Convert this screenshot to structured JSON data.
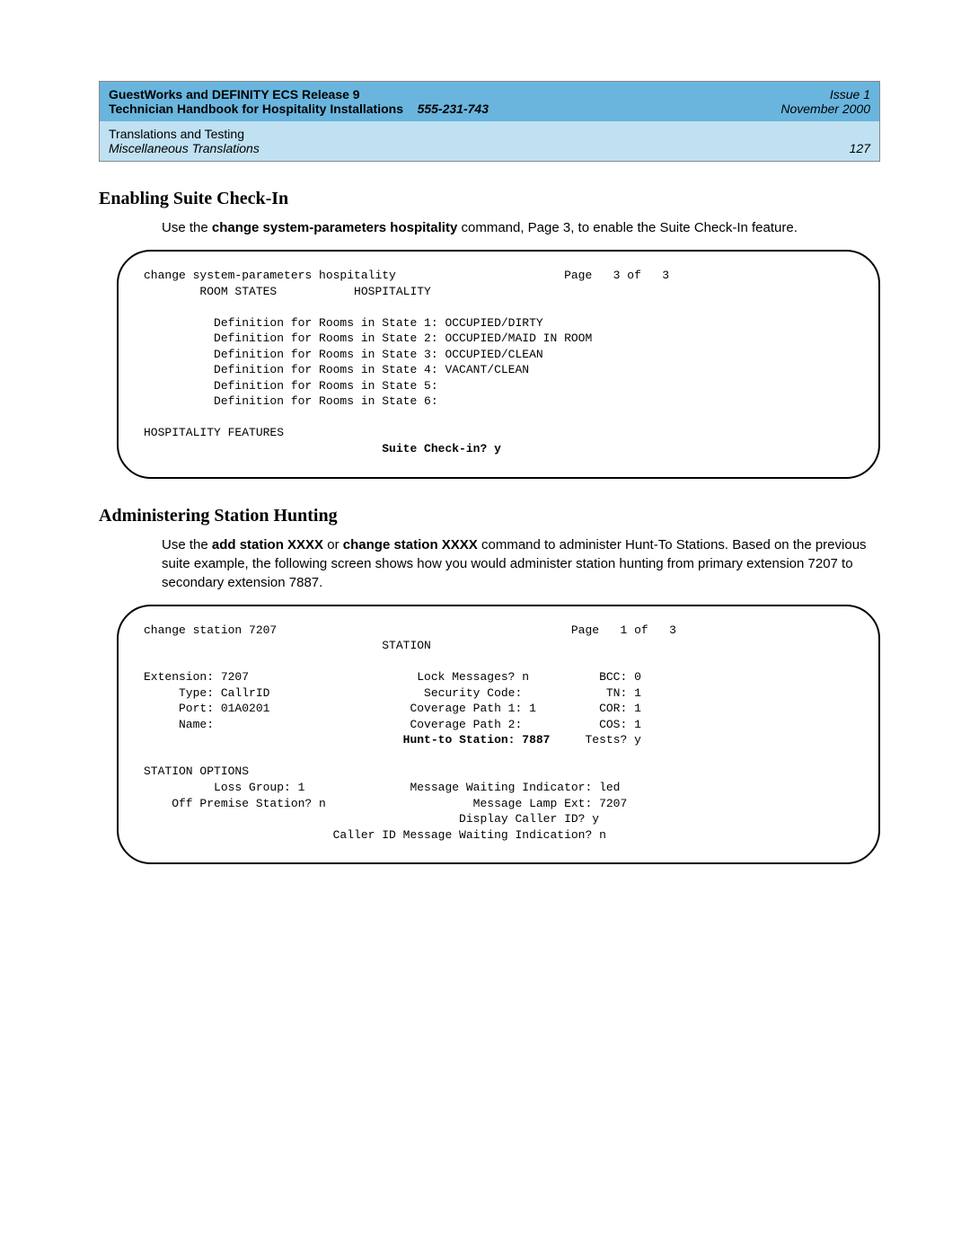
{
  "header": {
    "title_line1": "GuestWorks and DEFINITY ECS Release 9",
    "issue": "Issue 1",
    "title_line2a": "Technician Handbook for Hospitality Installations",
    "title_line2b": "555-231-743",
    "date": "November 2000",
    "chapter": "Translations and Testing",
    "section": "Miscellaneous Translations",
    "page_num": "127"
  },
  "sec1": {
    "heading": "Enabling Suite Check-In",
    "para_a": "Use the ",
    "para_cmd": "change system-parameters hospitality",
    "para_b": " command, Page 3, to enable the Suite Check-In feature."
  },
  "term1": {
    "l1": "change system-parameters hospitality                        Page   3 of   3",
    "l2": "        ROOM STATES           HOSPITALITY",
    "l3": "",
    "l4": "          Definition for Rooms in State 1: OCCUPIED/DIRTY",
    "l5": "          Definition for Rooms in State 2: OCCUPIED/MAID IN ROOM",
    "l6": "          Definition for Rooms in State 3: OCCUPIED/CLEAN",
    "l7": "          Definition for Rooms in State 4: VACANT/CLEAN",
    "l8": "          Definition for Rooms in State 5:",
    "l9": "          Definition for Rooms in State 6:",
    "l10": "",
    "l11": "HOSPITALITY FEATURES",
    "l12": "                                  Suite Check-in? y"
  },
  "sec2": {
    "heading": "Administering Station Hunting",
    "para_a": "Use the ",
    "para_cmd1": "add station XXXX",
    "para_mid": " or ",
    "para_cmd2": "change station XXXX",
    "para_b": " command to administer Hunt-To Stations. Based on the previous suite example, the following screen shows how you would administer station hunting from primary extension 7207 to secondary extension 7887."
  },
  "term2": {
    "l1": "change station 7207                                          Page   1 of   3",
    "l2": "                                  STATION",
    "l3": "",
    "l4": "Extension: 7207                        Lock Messages? n          BCC: 0",
    "l5": "     Type: CallrID                      Security Code:            TN: 1",
    "l6": "     Port: 01A0201                    Coverage Path 1: 1         COR: 1",
    "l7": "     Name:                            Coverage Path 2:           COS: 1",
    "l8a": "                                     ",
    "l8b": "Hunt-to Station: 7887",
    "l8c": "     Tests? y",
    "l9": "",
    "l10": "STATION OPTIONS",
    "l11": "          Loss Group: 1               Message Waiting Indicator: led",
    "l12": "    Off Premise Station? n                     Message Lamp Ext: 7207",
    "l13": "                                             Display Caller ID? y",
    "l14": "                           Caller ID Message Waiting Indication? n"
  }
}
